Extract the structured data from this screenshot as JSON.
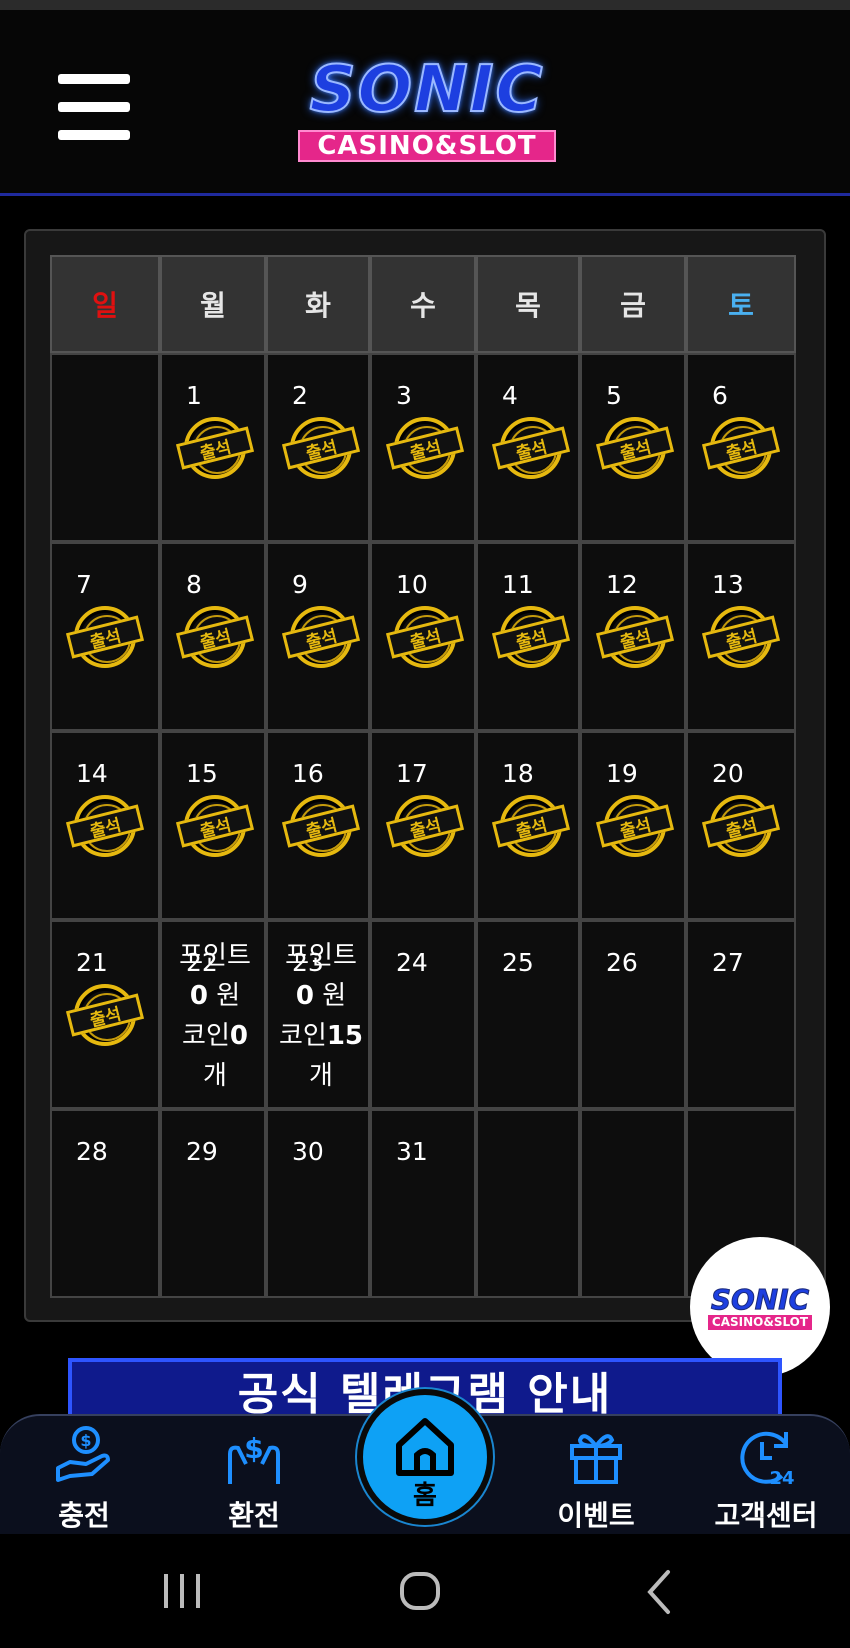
{
  "header": {
    "logo_main": "SONIC",
    "logo_sub": "CASINO&SLOT",
    "menu_icon": "hamburger-menu-icon"
  },
  "calendar": {
    "weekdays": [
      "일",
      "월",
      "화",
      "수",
      "목",
      "금",
      "토"
    ],
    "stamp_label": "출석",
    "weeks": [
      [
        {
          "day": ""
        },
        {
          "day": "1",
          "stamp": true
        },
        {
          "day": "2",
          "stamp": true
        },
        {
          "day": "3",
          "stamp": true
        },
        {
          "day": "4",
          "stamp": true
        },
        {
          "day": "5",
          "stamp": true
        },
        {
          "day": "6",
          "stamp": true
        }
      ],
      [
        {
          "day": "7",
          "stamp": true
        },
        {
          "day": "8",
          "stamp": true
        },
        {
          "day": "9",
          "stamp": true
        },
        {
          "day": "10",
          "stamp": true
        },
        {
          "day": "11",
          "stamp": true
        },
        {
          "day": "12",
          "stamp": true
        },
        {
          "day": "13",
          "stamp": true
        }
      ],
      [
        {
          "day": "14",
          "stamp": true
        },
        {
          "day": "15",
          "stamp": true
        },
        {
          "day": "16",
          "stamp": true
        },
        {
          "day": "17",
          "stamp": true
        },
        {
          "day": "18",
          "stamp": true
        },
        {
          "day": "19",
          "stamp": true
        },
        {
          "day": "20",
          "stamp": true
        }
      ],
      [
        {
          "day": "21",
          "stamp": true
        },
        {
          "day": "22",
          "points": "0",
          "coins": "0"
        },
        {
          "day": "23",
          "points": "0",
          "coins": "15"
        },
        {
          "day": "24"
        },
        {
          "day": "25"
        },
        {
          "day": "26"
        },
        {
          "day": "27"
        }
      ],
      [
        {
          "day": "28"
        },
        {
          "day": "29"
        },
        {
          "day": "30"
        },
        {
          "day": "31"
        },
        {
          "day": ""
        },
        {
          "day": ""
        },
        {
          "day": ""
        }
      ]
    ],
    "points_label": "포인트",
    "points_unit": "원",
    "coins_label": "코인",
    "coins_unit": "개"
  },
  "floating_logo": {
    "main": "SONIC",
    "sub": "CASINO&SLOT"
  },
  "banner": {
    "text": "공식 텔레그램 안내"
  },
  "bottom_nav": {
    "items": [
      {
        "label": "충전",
        "icon": "deposit-hand-icon"
      },
      {
        "label": "환전",
        "icon": "exchange-money-icon"
      },
      {
        "label": "홈",
        "icon": "home-icon"
      },
      {
        "label": "이벤트",
        "icon": "gift-icon"
      },
      {
        "label": "고객센터",
        "icon": "support-24-icon"
      }
    ]
  },
  "colors": {
    "sunday": "#e01010",
    "saturday": "#4ab0f0",
    "stamp_gold": "#e6b90f",
    "home_button": "#0ea1f5",
    "nav_icon": "#1e8fff"
  }
}
